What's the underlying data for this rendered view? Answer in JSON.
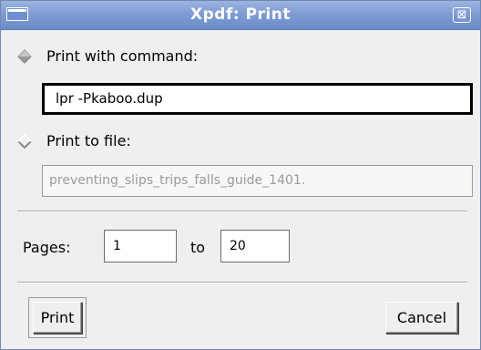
{
  "window": {
    "title": "Xpdf: Print",
    "close_glyph": "⊠"
  },
  "options": {
    "print_with_command": {
      "label": "Print with command:",
      "selected": true,
      "value": "lpr -Pkaboo.dup"
    },
    "print_to_file": {
      "label": "Print to file:",
      "selected": false,
      "value": "preventing_slips_trips_falls_guide_1401."
    }
  },
  "pages": {
    "label": "Pages:",
    "from": "1",
    "to_label": "to",
    "to": "20"
  },
  "buttons": {
    "print": "Print",
    "cancel": "Cancel"
  },
  "colors": {
    "titlebar": "#7f9dd4",
    "dialog_bg": "#efefef",
    "disabled_text": "#9a9a9a"
  },
  "icons": {
    "window_menu": "window-menu-icon",
    "close": "close-icon",
    "radio_on": "radio-selected-icon",
    "radio_off": "radio-unselected-icon"
  }
}
